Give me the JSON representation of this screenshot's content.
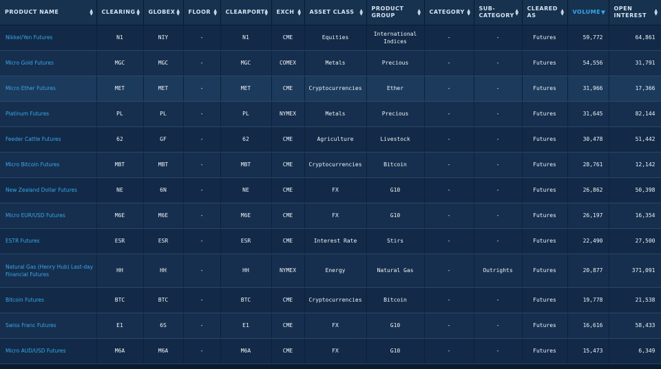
{
  "columns": [
    {
      "key": "product_name",
      "label": "PRODUCT NAME",
      "sort": "both"
    },
    {
      "key": "clearing",
      "label": "CLEARING",
      "sort": "both"
    },
    {
      "key": "globex",
      "label": "GLOBEX",
      "sort": "both"
    },
    {
      "key": "floor",
      "label": "FLOOR",
      "sort": "both"
    },
    {
      "key": "clearport",
      "label": "CLEARPORT",
      "sort": "both"
    },
    {
      "key": "exch",
      "label": "EXCH",
      "sort": "both"
    },
    {
      "key": "asset_class",
      "label": "ASSET CLASS",
      "sort": "both"
    },
    {
      "key": "product_group",
      "label": "PRODUCT GROUP",
      "sort": "both"
    },
    {
      "key": "category",
      "label": "CATEGORY",
      "sort": "both"
    },
    {
      "key": "sub_category",
      "label": "SUB-CATEGORY",
      "sort": "both"
    },
    {
      "key": "cleared_as",
      "label": "CLEARED AS",
      "sort": "both"
    },
    {
      "key": "volume",
      "label": "VOLUME",
      "sort": "desc",
      "active": true
    },
    {
      "key": "open_interest",
      "label": "OPEN INTEREST",
      "sort": "both"
    }
  ],
  "rows": [
    {
      "product_name": "Nikkei/Yen Futures",
      "clearing": "N1",
      "globex": "NIY",
      "floor": "-",
      "clearport": "N1",
      "exch": "CME",
      "asset_class": "Equities",
      "product_group": "International Indices",
      "category": "-",
      "sub_category": "-",
      "cleared_as": "Futures",
      "volume": "59,772",
      "open_interest": "64,861"
    },
    {
      "product_name": "Micro Gold Futures",
      "clearing": "MGC",
      "globex": "MGC",
      "floor": "-",
      "clearport": "MGC",
      "exch": "COMEX",
      "asset_class": "Metals",
      "product_group": "Precious",
      "category": "-",
      "sub_category": "-",
      "cleared_as": "Futures",
      "volume": "54,556",
      "open_interest": "31,791"
    },
    {
      "product_name": "Micro Ether Futures",
      "clearing": "MET",
      "globex": "MET",
      "floor": "-",
      "clearport": "MET",
      "exch": "CME",
      "asset_class": "Cryptocurrencies",
      "product_group": "Ether",
      "category": "-",
      "sub_category": "-",
      "cleared_as": "Futures",
      "volume": "31,966",
      "open_interest": "17,366",
      "highlight": true
    },
    {
      "product_name": "Platinum Futures",
      "clearing": "PL",
      "globex": "PL",
      "floor": "-",
      "clearport": "PL",
      "exch": "NYMEX",
      "asset_class": "Metals",
      "product_group": "Precious",
      "category": "-",
      "sub_category": "-",
      "cleared_as": "Futures",
      "volume": "31,645",
      "open_interest": "82,144"
    },
    {
      "product_name": "Feeder Cattle Futures",
      "clearing": "62",
      "globex": "GF",
      "floor": "-",
      "clearport": "62",
      "exch": "CME",
      "asset_class": "Agriculture",
      "product_group": "Livestock",
      "category": "-",
      "sub_category": "-",
      "cleared_as": "Futures",
      "volume": "30,478",
      "open_interest": "51,442"
    },
    {
      "product_name": "Micro Bitcoin Futures",
      "clearing": "MBT",
      "globex": "MBT",
      "floor": "-",
      "clearport": "MBT",
      "exch": "CME",
      "asset_class": "Cryptocurrencies",
      "product_group": "Bitcoin",
      "category": "-",
      "sub_category": "-",
      "cleared_as": "Futures",
      "volume": "28,761",
      "open_interest": "12,142"
    },
    {
      "product_name": "New Zealand Dollar Futures",
      "clearing": "NE",
      "globex": "6N",
      "floor": "-",
      "clearport": "NE",
      "exch": "CME",
      "asset_class": "FX",
      "product_group": "G10",
      "category": "-",
      "sub_category": "-",
      "cleared_as": "Futures",
      "volume": "26,862",
      "open_interest": "50,398"
    },
    {
      "product_name": "Micro EUR/USD Futures",
      "clearing": "M6E",
      "globex": "M6E",
      "floor": "-",
      "clearport": "M6E",
      "exch": "CME",
      "asset_class": "FX",
      "product_group": "G10",
      "category": "-",
      "sub_category": "-",
      "cleared_as": "Futures",
      "volume": "26,197",
      "open_interest": "16,354"
    },
    {
      "product_name": "ESTR Futures",
      "clearing": "ESR",
      "globex": "ESR",
      "floor": "-",
      "clearport": "ESR",
      "exch": "CME",
      "asset_class": "Interest Rate",
      "product_group": "Stirs",
      "category": "-",
      "sub_category": "-",
      "cleared_as": "Futures",
      "volume": "22,490",
      "open_interest": "27,500"
    },
    {
      "product_name": "Natural Gas (Henry Hub) Last-day Financial Futures",
      "clearing": "HH",
      "globex": "HH",
      "floor": "-",
      "clearport": "HH",
      "exch": "NYMEX",
      "asset_class": "Energy",
      "product_group": "Natural Gas",
      "category": "-",
      "sub_category": "Outrights",
      "cleared_as": "Futures",
      "volume": "20,877",
      "open_interest": "371,091",
      "tall": true
    },
    {
      "product_name": "Bitcoin Futures",
      "clearing": "BTC",
      "globex": "BTC",
      "floor": "-",
      "clearport": "BTC",
      "exch": "CME",
      "asset_class": "Cryptocurrencies",
      "product_group": "Bitcoin",
      "category": "-",
      "sub_category": "-",
      "cleared_as": "Futures",
      "volume": "19,778",
      "open_interest": "21,538"
    },
    {
      "product_name": "Swiss Franc Futures",
      "clearing": "E1",
      "globex": "6S",
      "floor": "-",
      "clearport": "E1",
      "exch": "CME",
      "asset_class": "FX",
      "product_group": "G10",
      "category": "-",
      "sub_category": "-",
      "cleared_as": "Futures",
      "volume": "16,616",
      "open_interest": "58,433"
    },
    {
      "product_name": "Micro AUD/USD Futures",
      "clearing": "M6A",
      "globex": "M6A",
      "floor": "-",
      "clearport": "M6A",
      "exch": "CME",
      "asset_class": "FX",
      "product_group": "G10",
      "category": "-",
      "sub_category": "-",
      "cleared_as": "Futures",
      "volume": "15,473",
      "open_interest": "6,349"
    }
  ],
  "colors": {
    "link": "#3aa8ea",
    "header_bg": "#16324f",
    "row_bg": "#122a47",
    "active_header": "#38a7ee"
  },
  "icons": {
    "sort": "sort-both-icon",
    "sort_desc": "sort-desc-icon"
  }
}
